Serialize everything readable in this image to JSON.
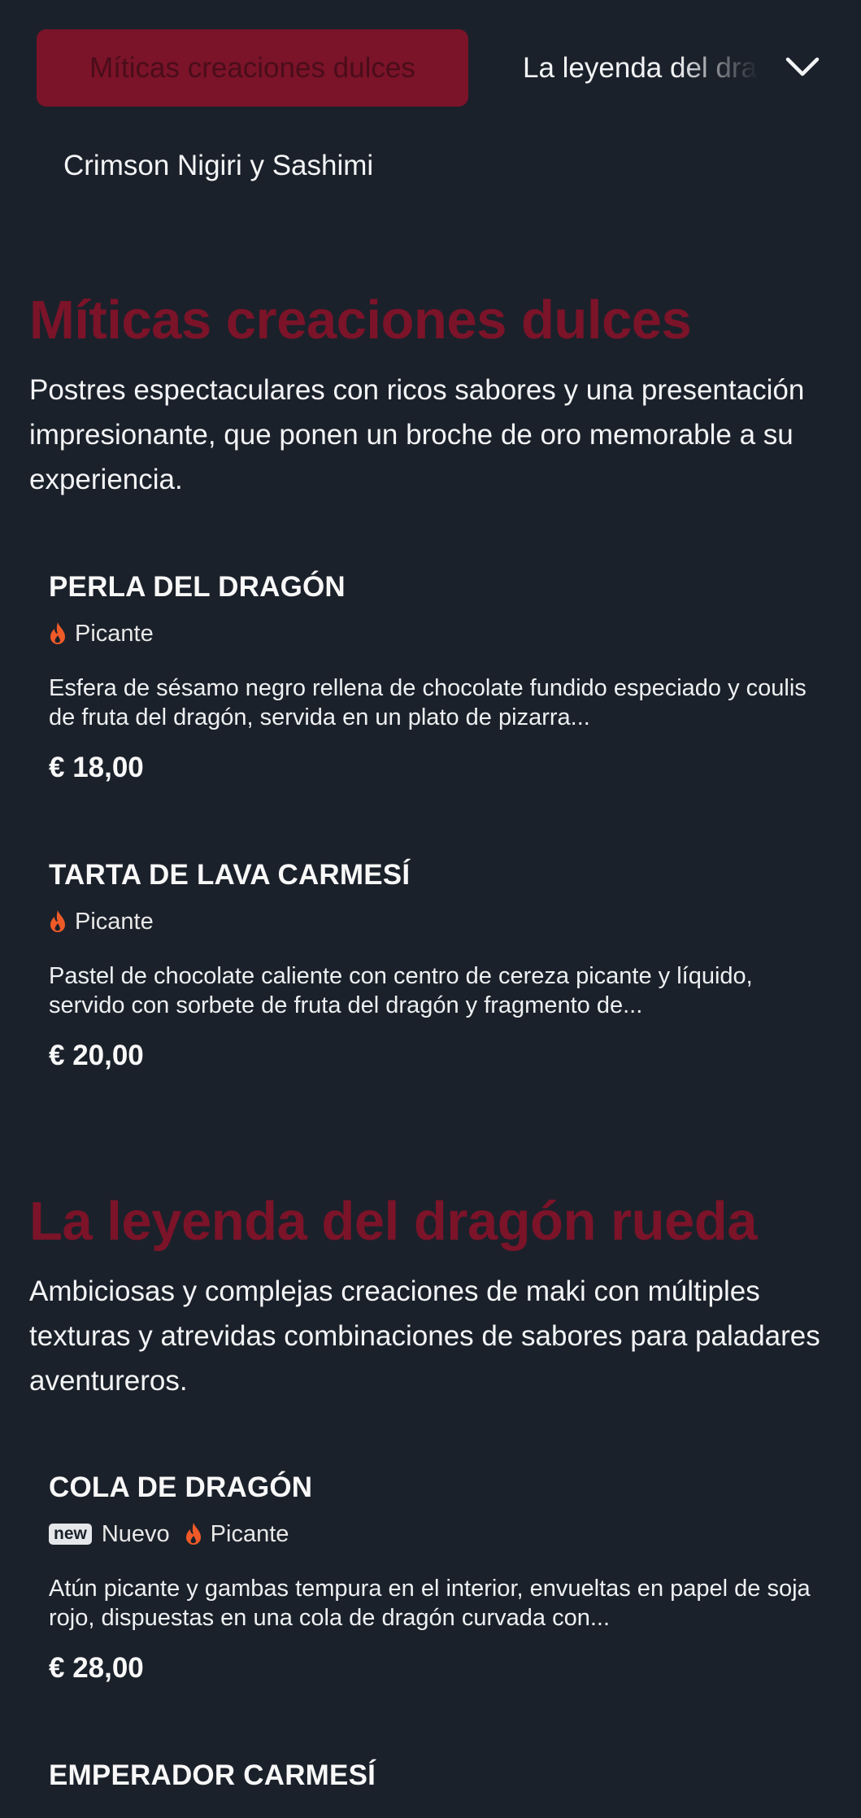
{
  "nav": {
    "active_category": "Míticas creaciones dulces",
    "next_category": "La leyenda del dragón rueda",
    "second_row_category": "Crimson Nigiri y Sashimi",
    "expand_icon": "chevron-down-icon"
  },
  "colors": {
    "background": "#1b212a",
    "accent": "#7b1329",
    "flame": "#f05a28",
    "text": "#f3f4f6"
  },
  "sections": [
    {
      "title": "Míticas creaciones dulces",
      "description": "Postres espectaculares con ricos sabores y una presentación impresionante, que ponen un broche de oro memorable a su experiencia.",
      "items": [
        {
          "name": "PERLA DEL DRAGÓN",
          "tag_spicy": "Picante",
          "description": "Esfera de sésamo negro rellena de chocolate fundido especiado y coulis de fruta del dragón, servida en un plato de pizarra...",
          "price": "€ 18,00"
        },
        {
          "name": "TARTA DE LAVA CARMESÍ",
          "tag_spicy": "Picante",
          "description": "Pastel de chocolate caliente con centro de cereza picante y líquido, servido con sorbete de fruta del dragón y fragmento de...",
          "price": "€ 20,00"
        }
      ]
    },
    {
      "title": "La leyenda del dragón rueda",
      "description": "Ambiciosas y complejas creaciones de maki con múltiples texturas y atrevidas combinaciones de sabores para paladares aventureros.",
      "items": [
        {
          "name": "COLA DE DRAGÓN",
          "badge_new": "new",
          "tag_new": "Nuevo",
          "tag_spicy": "Picante",
          "description": "Atún picante y gambas tempura en el interior, envueltas en papel de soja rojo, dispuestas en una cola de dragón curvada con...",
          "price": "€ 28,00"
        },
        {
          "name": "EMPERADOR CARMESÍ"
        }
      ]
    }
  ]
}
